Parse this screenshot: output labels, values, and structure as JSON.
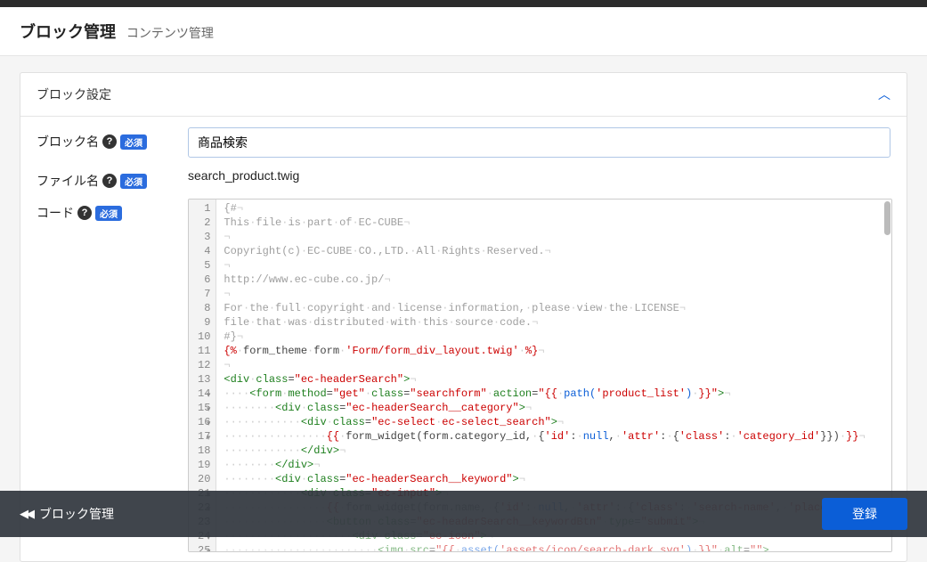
{
  "header": {
    "title": "ブロック管理",
    "subtitle": "コンテンツ管理"
  },
  "panel": {
    "title": "ブロック設定"
  },
  "form": {
    "block_name": {
      "label": "ブロック名",
      "required": "必須",
      "value": "商品検索"
    },
    "file_name": {
      "label": "ファイル名",
      "required": "必須",
      "value": "search_product.twig"
    },
    "code": {
      "label": "コード",
      "required": "必須"
    }
  },
  "code_lines": [
    {
      "n": 1,
      "fold": false,
      "segs": [
        [
          "comment",
          "{#"
        ],
        [
          "ws",
          "¬"
        ]
      ]
    },
    {
      "n": 2,
      "fold": false,
      "segs": [
        [
          "comment",
          "This"
        ],
        [
          "dot",
          ""
        ],
        [
          "comment",
          "file"
        ],
        [
          "dot",
          ""
        ],
        [
          "comment",
          "is"
        ],
        [
          "dot",
          ""
        ],
        [
          "comment",
          "part"
        ],
        [
          "dot",
          ""
        ],
        [
          "comment",
          "of"
        ],
        [
          "dot",
          ""
        ],
        [
          "comment",
          "EC-CUBE"
        ],
        [
          "ws",
          "¬"
        ]
      ]
    },
    {
      "n": 3,
      "fold": false,
      "segs": [
        [
          "ws",
          "¬"
        ]
      ]
    },
    {
      "n": 4,
      "fold": false,
      "segs": [
        [
          "comment",
          "Copyright(c)"
        ],
        [
          "dot",
          ""
        ],
        [
          "comment",
          "EC-CUBE"
        ],
        [
          "dot",
          ""
        ],
        [
          "comment",
          "CO.,LTD."
        ],
        [
          "dot",
          ""
        ],
        [
          "comment",
          "All"
        ],
        [
          "dot",
          ""
        ],
        [
          "comment",
          "Rights"
        ],
        [
          "dot",
          ""
        ],
        [
          "comment",
          "Reserved."
        ],
        [
          "ws",
          "¬"
        ]
      ]
    },
    {
      "n": 5,
      "fold": false,
      "segs": [
        [
          "ws",
          "¬"
        ]
      ]
    },
    {
      "n": 6,
      "fold": false,
      "segs": [
        [
          "comment",
          "http://www.ec-cube.co.jp/"
        ],
        [
          "ws",
          "¬"
        ]
      ]
    },
    {
      "n": 7,
      "fold": false,
      "segs": [
        [
          "ws",
          "¬"
        ]
      ]
    },
    {
      "n": 8,
      "fold": false,
      "segs": [
        [
          "comment",
          "For"
        ],
        [
          "dot",
          ""
        ],
        [
          "comment",
          "the"
        ],
        [
          "dot",
          ""
        ],
        [
          "comment",
          "full"
        ],
        [
          "dot",
          ""
        ],
        [
          "comment",
          "copyright"
        ],
        [
          "dot",
          ""
        ],
        [
          "comment",
          "and"
        ],
        [
          "dot",
          ""
        ],
        [
          "comment",
          "license"
        ],
        [
          "dot",
          ""
        ],
        [
          "comment",
          "information,"
        ],
        [
          "dot",
          ""
        ],
        [
          "comment",
          "please"
        ],
        [
          "dot",
          ""
        ],
        [
          "comment",
          "view"
        ],
        [
          "dot",
          ""
        ],
        [
          "comment",
          "the"
        ],
        [
          "dot",
          ""
        ],
        [
          "comment",
          "LICENSE"
        ],
        [
          "ws",
          "¬"
        ]
      ]
    },
    {
      "n": 9,
      "fold": false,
      "segs": [
        [
          "comment",
          "file"
        ],
        [
          "dot",
          ""
        ],
        [
          "comment",
          "that"
        ],
        [
          "dot",
          ""
        ],
        [
          "comment",
          "was"
        ],
        [
          "dot",
          ""
        ],
        [
          "comment",
          "distributed"
        ],
        [
          "dot",
          ""
        ],
        [
          "comment",
          "with"
        ],
        [
          "dot",
          ""
        ],
        [
          "comment",
          "this"
        ],
        [
          "dot",
          ""
        ],
        [
          "comment",
          "source"
        ],
        [
          "dot",
          ""
        ],
        [
          "comment",
          "code."
        ],
        [
          "ws",
          "¬"
        ]
      ]
    },
    {
      "n": 10,
      "fold": false,
      "segs": [
        [
          "comment",
          "#}"
        ],
        [
          "ws",
          "¬"
        ]
      ]
    },
    {
      "n": 11,
      "fold": false,
      "segs": [
        [
          "twig",
          "{%"
        ],
        [
          "dot",
          ""
        ],
        [
          "text",
          "form_theme"
        ],
        [
          "dot",
          ""
        ],
        [
          "text",
          "form"
        ],
        [
          "dot",
          ""
        ],
        [
          "str",
          "'Form/form_div_layout.twig'"
        ],
        [
          "dot",
          ""
        ],
        [
          "twig",
          "%}"
        ],
        [
          "ws",
          "¬"
        ]
      ]
    },
    {
      "n": 12,
      "fold": false,
      "segs": [
        [
          "ws",
          "¬"
        ]
      ]
    },
    {
      "n": 13,
      "fold": true,
      "segs": [
        [
          "tag",
          "<div"
        ],
        [
          "dot",
          ""
        ],
        [
          "attr",
          "class"
        ],
        [
          "text",
          "="
        ],
        [
          "str",
          "\"ec-headerSearch\""
        ],
        [
          "tag",
          ">"
        ],
        [
          "ws",
          "¬"
        ]
      ]
    },
    {
      "n": 14,
      "fold": true,
      "indent": 1,
      "segs": [
        [
          "tag",
          "<form"
        ],
        [
          "dot",
          ""
        ],
        [
          "attr",
          "method"
        ],
        [
          "text",
          "="
        ],
        [
          "str",
          "\"get\""
        ],
        [
          "dot",
          ""
        ],
        [
          "attr",
          "class"
        ],
        [
          "text",
          "="
        ],
        [
          "str",
          "\"searchform\""
        ],
        [
          "dot",
          ""
        ],
        [
          "attr",
          "action"
        ],
        [
          "text",
          "="
        ],
        [
          "str",
          "\"{{"
        ],
        [
          "dot",
          ""
        ],
        [
          "twigfn",
          "path("
        ],
        [
          "str",
          "'product_list'"
        ],
        [
          "twigfn",
          ")"
        ],
        [
          "dot",
          ""
        ],
        [
          "str",
          "}}\""
        ],
        [
          "tag",
          ">"
        ],
        [
          "ws",
          "¬"
        ]
      ]
    },
    {
      "n": 15,
      "fold": true,
      "indent": 2,
      "segs": [
        [
          "tag",
          "<div"
        ],
        [
          "dot",
          ""
        ],
        [
          "attr",
          "class"
        ],
        [
          "text",
          "="
        ],
        [
          "str",
          "\"ec-headerSearch__category\""
        ],
        [
          "tag",
          ">"
        ],
        [
          "ws",
          "¬"
        ]
      ]
    },
    {
      "n": 16,
      "fold": true,
      "indent": 3,
      "segs": [
        [
          "tag",
          "<div"
        ],
        [
          "dot",
          ""
        ],
        [
          "attr",
          "class"
        ],
        [
          "text",
          "="
        ],
        [
          "str",
          "\"ec-select"
        ],
        [
          "dot",
          ""
        ],
        [
          "str",
          "ec-select_search\""
        ],
        [
          "tag",
          ">"
        ],
        [
          "ws",
          "¬"
        ]
      ]
    },
    {
      "n": 17,
      "fold": false,
      "indent": 4,
      "segs": [
        [
          "twig",
          "{{"
        ],
        [
          "dot",
          ""
        ],
        [
          "text",
          "form_widget(form.category_id,"
        ],
        [
          "dot",
          ""
        ],
        [
          "text",
          "{"
        ],
        [
          "str",
          "'id'"
        ],
        [
          "text",
          ":"
        ],
        [
          "dot",
          ""
        ],
        [
          "twigfn",
          "null"
        ],
        [
          "text",
          ","
        ],
        [
          "dot",
          ""
        ],
        [
          "str",
          "'attr'"
        ],
        [
          "text",
          ":"
        ],
        [
          "dot",
          ""
        ],
        [
          "text",
          "{"
        ],
        [
          "str",
          "'class'"
        ],
        [
          "text",
          ":"
        ],
        [
          "dot",
          ""
        ],
        [
          "str",
          "'category_id'"
        ],
        [
          "text",
          "}})"
        ],
        [
          "dot",
          ""
        ],
        [
          "twig",
          "}}"
        ],
        [
          "ws",
          "¬"
        ]
      ]
    },
    {
      "n": 18,
      "fold": false,
      "indent": 3,
      "segs": [
        [
          "tag",
          "</div>"
        ],
        [
          "ws",
          "¬"
        ]
      ]
    },
    {
      "n": 19,
      "fold": false,
      "indent": 2,
      "segs": [
        [
          "tag",
          "</div>"
        ],
        [
          "ws",
          "¬"
        ]
      ]
    },
    {
      "n": 20,
      "fold": true,
      "indent": 2,
      "segs": [
        [
          "tag",
          "<div"
        ],
        [
          "dot",
          ""
        ],
        [
          "attr",
          "class"
        ],
        [
          "text",
          "="
        ],
        [
          "str",
          "\"ec-headerSearch__keyword\""
        ],
        [
          "tag",
          ">"
        ],
        [
          "ws",
          "¬"
        ]
      ]
    },
    {
      "n": 21,
      "fold": true,
      "indent": 3,
      "segs": [
        [
          "tag",
          "<div"
        ],
        [
          "dot",
          ""
        ],
        [
          "attr",
          "class"
        ],
        [
          "text",
          "="
        ],
        [
          "str",
          "\"ec-input\""
        ],
        [
          "tag",
          ">"
        ],
        [
          "ws",
          "¬"
        ]
      ]
    },
    {
      "n": 22,
      "fold": false,
      "indent": 4,
      "dim": true,
      "segs": [
        [
          "twig",
          "{{"
        ],
        [
          "dot",
          ""
        ],
        [
          "text",
          "form_widget(form.name,"
        ],
        [
          "dot",
          ""
        ],
        [
          "text",
          "{"
        ],
        [
          "str",
          "'id'"
        ],
        [
          "text",
          ":"
        ],
        [
          "dot",
          ""
        ],
        [
          "twigfn",
          "null"
        ],
        [
          "text",
          ","
        ],
        [
          "dot",
          ""
        ],
        [
          "str",
          "'attr'"
        ],
        [
          "text",
          ":"
        ],
        [
          "dot",
          ""
        ],
        [
          "text",
          "{"
        ],
        [
          "str",
          "'class'"
        ],
        [
          "text",
          ":"
        ],
        [
          "dot",
          ""
        ],
        [
          "str",
          "'search-name'"
        ],
        [
          "text",
          ","
        ],
        [
          "dot",
          ""
        ],
        [
          "str",
          "'placeholder'"
        ],
        [
          "text",
          ":"
        ],
        [
          "dot",
          ""
        ]
      ]
    },
    {
      "n": 23,
      "fold": true,
      "indent": 4,
      "dim": true,
      "segs": [
        [
          "tag",
          "<button"
        ],
        [
          "dot",
          ""
        ],
        [
          "attr",
          "class"
        ],
        [
          "text",
          "="
        ],
        [
          "str",
          "\"ec-headerSearch__keywordBtn\""
        ],
        [
          "dot",
          ""
        ],
        [
          "attr",
          "type"
        ],
        [
          "text",
          "="
        ],
        [
          "str",
          "\"submit\""
        ],
        [
          "tag",
          ">"
        ],
        [
          "ws",
          "¬"
        ]
      ]
    },
    {
      "n": 24,
      "fold": true,
      "indent": 5,
      "dim": true,
      "segs": [
        [
          "tag",
          "<div"
        ],
        [
          "dot",
          ""
        ],
        [
          "attr",
          "class"
        ],
        [
          "text",
          "="
        ],
        [
          "str",
          "\"ec-icon\""
        ],
        [
          "tag",
          ">"
        ],
        [
          "ws",
          "¬"
        ]
      ]
    },
    {
      "n": 25,
      "fold": false,
      "indent": 6,
      "dim": true,
      "segs": [
        [
          "tag",
          "<img"
        ],
        [
          "dot",
          ""
        ],
        [
          "attr",
          "src"
        ],
        [
          "text",
          "="
        ],
        [
          "str",
          "\"{{"
        ],
        [
          "dot",
          ""
        ],
        [
          "twigfn",
          "asset("
        ],
        [
          "str",
          "'assets/icon/search-dark.svg'"
        ],
        [
          "twigfn",
          ")"
        ],
        [
          "dot",
          ""
        ],
        [
          "str",
          "}}\""
        ],
        [
          "dot",
          ""
        ],
        [
          "attr",
          "alt"
        ],
        [
          "text",
          "="
        ],
        [
          "str",
          "\"\""
        ],
        [
          "tag",
          ">"
        ]
      ]
    }
  ],
  "footer": {
    "back_label": "ブロック管理",
    "save_label": "登録"
  }
}
